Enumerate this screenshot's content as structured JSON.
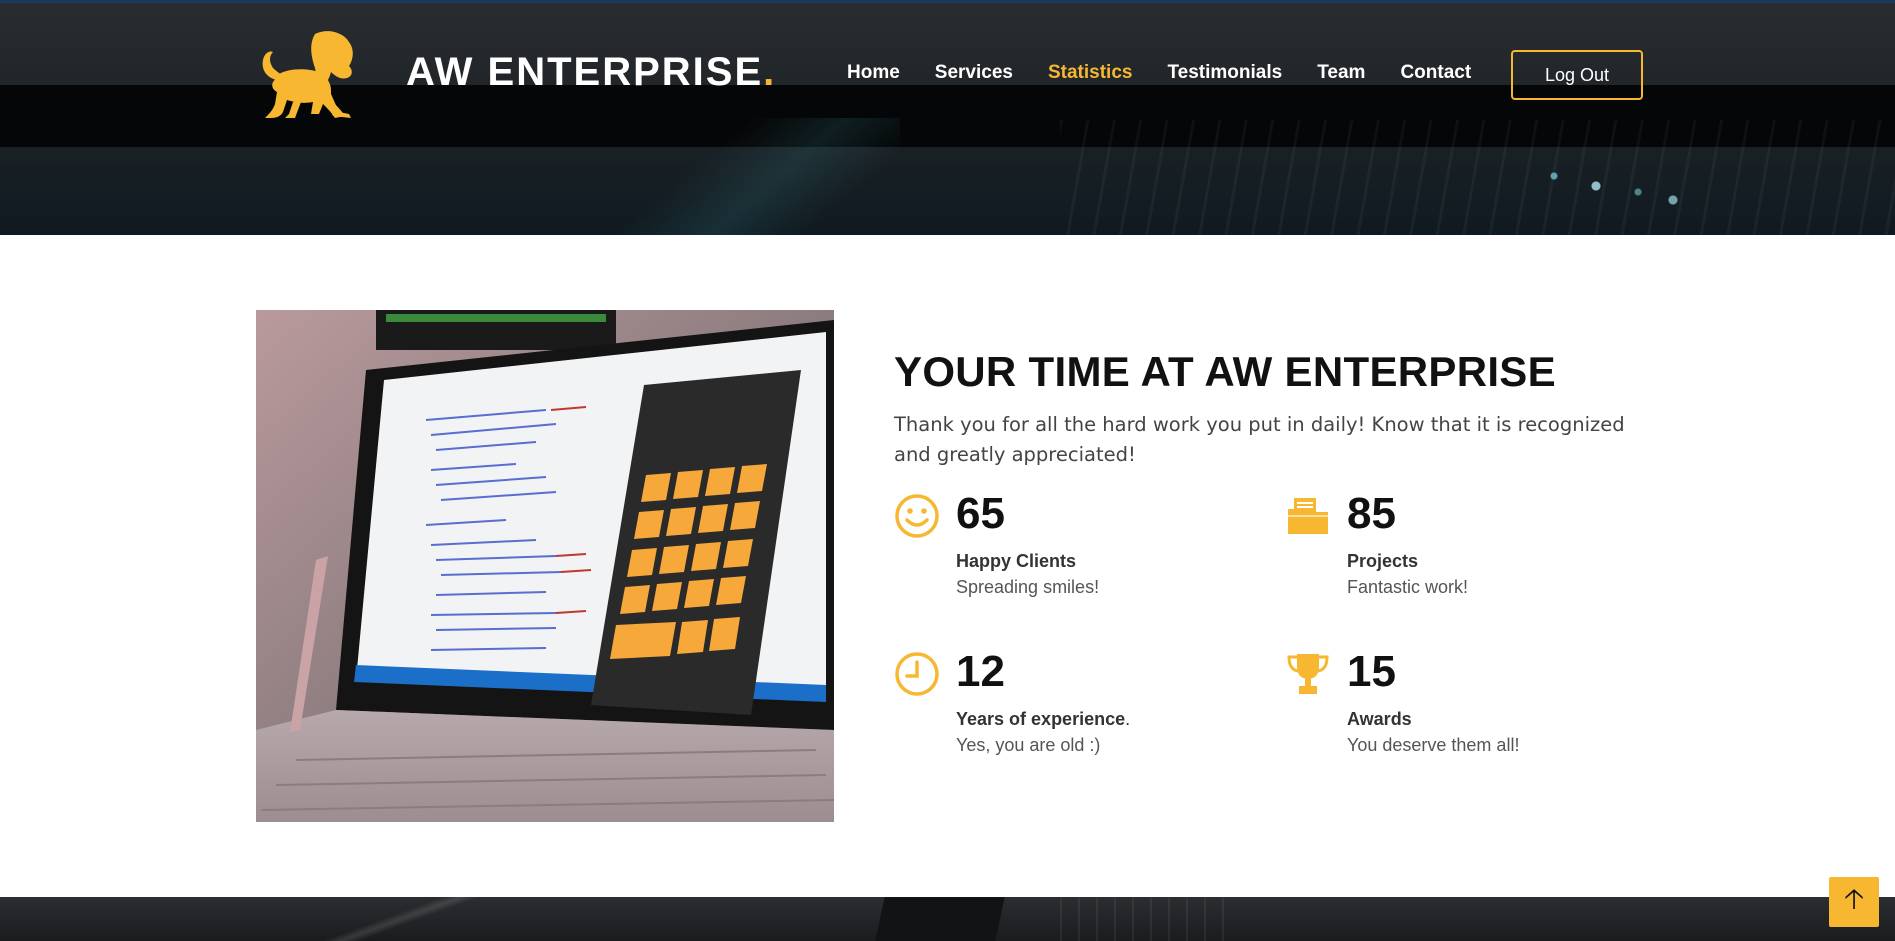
{
  "header": {
    "brand_text": "AW ENTERPRISE",
    "brand_dot": ".",
    "logo_icon": "lion-logo-icon",
    "nav": [
      {
        "label": "Home",
        "active": false
      },
      {
        "label": "Services",
        "active": false
      },
      {
        "label": "Statistics",
        "active": true
      },
      {
        "label": "Testimonials",
        "active": false
      },
      {
        "label": "Team",
        "active": false
      },
      {
        "label": "Contact",
        "active": false
      }
    ],
    "logout_label": "Log Out"
  },
  "colors": {
    "accent": "#f7b731",
    "heading": "#111111",
    "text": "#444444"
  },
  "main": {
    "title": "YOUR TIME AT AW ENTERPRISE",
    "lead": "Thank you for all the hard work you put in daily! Know that it is recognized and greatly appreciated!",
    "image_icon": "laptop-calculator-photo",
    "stats": [
      {
        "icon": "smiley-icon",
        "number": "65",
        "label": "Happy Clients",
        "label_trail": "",
        "desc": "Spreading smiles!"
      },
      {
        "icon": "folder-icon",
        "number": "85",
        "label": "Projects",
        "label_trail": "",
        "desc": "Fantastic work!"
      },
      {
        "icon": "clock-icon",
        "number": "12",
        "label": "Years of experience",
        "label_trail": ".",
        "desc": "Yes, you are old :)"
      },
      {
        "icon": "trophy-icon",
        "number": "15",
        "label": "Awards",
        "label_trail": "",
        "desc": "You deserve them all!"
      }
    ]
  },
  "scroll_top": {
    "icon": "arrow-up-icon",
    "glyph": "🡡"
  }
}
